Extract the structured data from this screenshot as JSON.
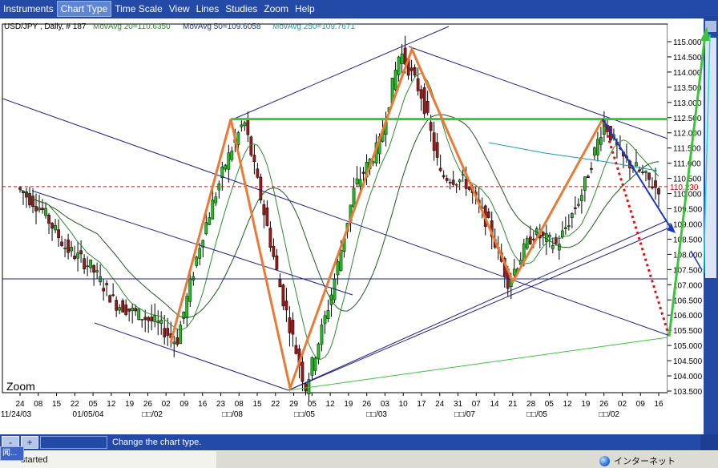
{
  "menu": {
    "items": [
      {
        "label": "Instruments",
        "name": "menu-instruments",
        "active": false
      },
      {
        "label": "Chart Type",
        "name": "menu-chart-type",
        "active": true
      },
      {
        "label": "Time Scale",
        "name": "menu-time-scale",
        "active": false
      },
      {
        "label": "View",
        "name": "menu-view",
        "active": false
      },
      {
        "label": "Lines",
        "name": "menu-lines",
        "active": false
      },
      {
        "label": "Studies",
        "name": "menu-studies",
        "active": false
      },
      {
        "label": "Zoom",
        "name": "menu-zoom",
        "active": false
      },
      {
        "label": "Help",
        "name": "menu-help",
        "active": false
      }
    ]
  },
  "chart": {
    "header_symbol": "USD/JPY , Daily, # 187",
    "header_ma20": "MovAvg 20=110.6350",
    "header_ma50": "MovAvg 50=109.6058",
    "header_ma250": "MovAvg 250=109.7671",
    "current_price_label": "110.230",
    "zoom_label": "Zoom",
    "colors": {
      "bull": "#2eb82e",
      "bear": "#8f1e1e",
      "ma20": "#2f8a2f",
      "ma50": "#1c5a1c",
      "ma250": "#1a9bb0",
      "trendline": "#1f1f8a",
      "zigzag": "#ea7a35",
      "resistance": "#3cc43c",
      "projection": "#dd1111",
      "arrow_blue": "#1636c8",
      "arrow_green": "#3cc43c",
      "arrow_cyan": "#28d8e6"
    }
  },
  "chart_data": {
    "type": "candlestick",
    "instrument": "USD/JPY",
    "interval": "Daily",
    "ylim": [
      103.2,
      115.4
    ],
    "yticks": [
      103.5,
      104.0,
      104.5,
      105.0,
      105.5,
      106.0,
      106.5,
      107.0,
      107.5,
      108.0,
      108.5,
      109.0,
      109.5,
      110.0,
      110.5,
      111.0,
      111.5,
      112.0,
      112.5,
      113.0,
      113.5,
      114.0,
      114.5,
      115.0
    ],
    "ytick_labels": [
      "103.500",
      "104.000",
      "104.500",
      "105.000",
      "105.500",
      "106.000",
      "106.500",
      "107.000",
      "107.500",
      "108.000",
      "108.500",
      "109.000",
      "109.500",
      "110.000",
      "110.500",
      "111.000",
      "111.500",
      "112.000",
      "112.500",
      "113.000",
      "113.500",
      "114.000",
      "114.500",
      "115.000"
    ],
    "x_days": [
      "24",
      "08",
      "15",
      "22",
      "05",
      "12",
      "19",
      "26",
      "02",
      "09",
      "16",
      "23",
      "08",
      "15",
      "22",
      "29",
      "05",
      "12",
      "19",
      "26",
      "03",
      "10",
      "17",
      "24",
      "31",
      "07",
      "14",
      "21",
      "28",
      "05",
      "12",
      "19",
      "26",
      "02",
      "09",
      "16"
    ],
    "x_periods": [
      "11/24/03",
      "01/05/04",
      "□□/02",
      "□□/08",
      "□□/05",
      "□□/03",
      "□□/07",
      "□□/05",
      "□□/02"
    ],
    "zigzag_points": [
      {
        "bar": 0,
        "price": 105.1
      },
      {
        "bar": 1,
        "price": 112.4
      },
      {
        "bar": 2,
        "price": 103.6
      },
      {
        "bar": 3,
        "price": 114.7
      },
      {
        "bar": 4,
        "price": 107.1
      },
      {
        "bar": 5,
        "price": 112.4
      }
    ],
    "horizontal_levels": [
      {
        "name": "resistance",
        "price": 112.45
      },
      {
        "name": "current",
        "price": 110.23
      },
      {
        "name": "support",
        "price": 107.1
      }
    ],
    "moving_averages": [
      {
        "name": "MovAvg 20",
        "value": 110.635
      },
      {
        "name": "MovAvg 50",
        "value": 109.6058
      },
      {
        "name": "MovAvg 250",
        "value": 109.7671
      }
    ],
    "projection_target": 105.3
  },
  "status": {
    "message": "Change the chart type.",
    "toolbar_plus": "+",
    "toolbar_minus": "-"
  },
  "taskbar": {
    "task_label": "started",
    "zone_label": "インターネット",
    "popup_label": "闻..."
  }
}
